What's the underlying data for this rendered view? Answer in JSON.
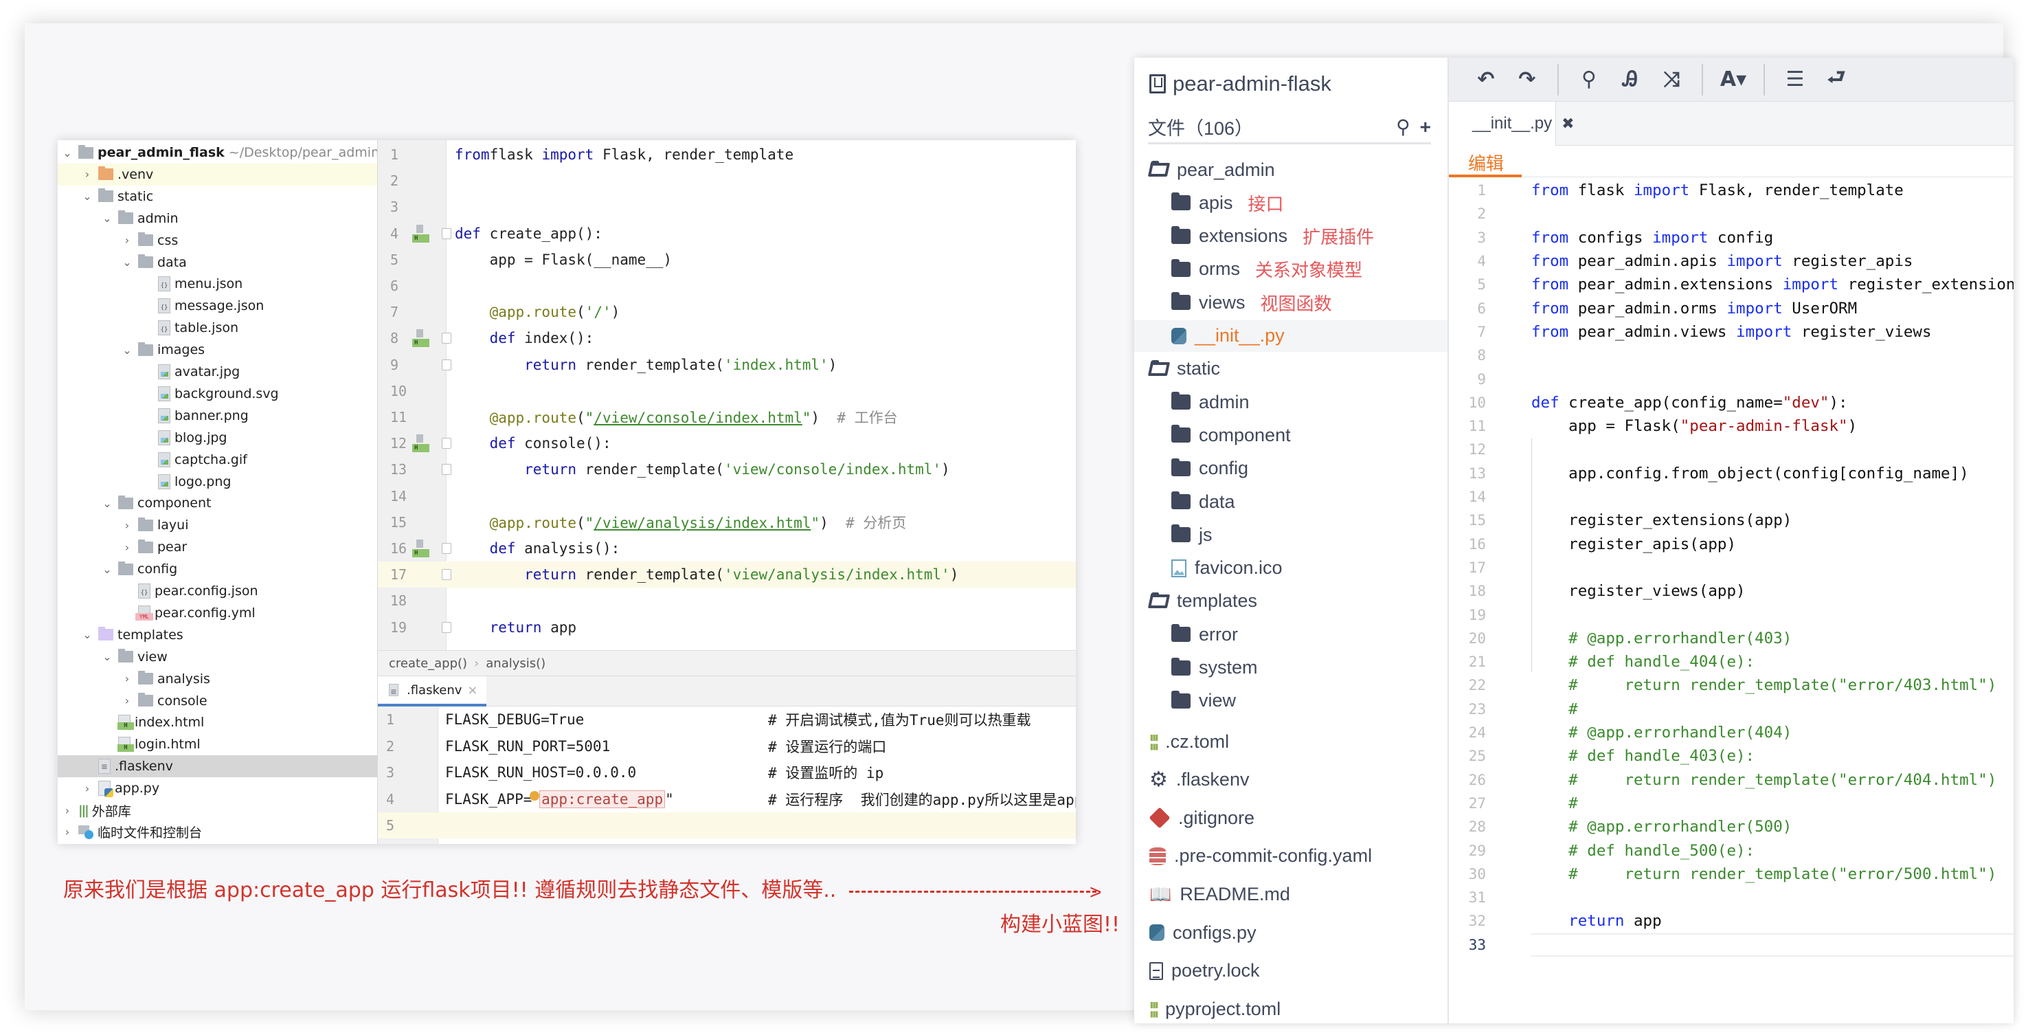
{
  "left_ide": {
    "project_tree": [
      {
        "label": "pear_admin_flask",
        "suffix": "~/Desktop/pear_admin",
        "depth": 0,
        "chevron": "down",
        "icon": "folder-icon",
        "bold": true
      },
      {
        "label": ".venv",
        "depth": 1,
        "chevron": "right",
        "icon": "folder-excluded-icon",
        "highlight": "yellow"
      },
      {
        "label": "static",
        "depth": 1,
        "chevron": "down",
        "icon": "folder-icon"
      },
      {
        "label": "admin",
        "depth": 2,
        "chevron": "down",
        "icon": "folder-icon"
      },
      {
        "label": "css",
        "depth": 3,
        "chevron": "right",
        "icon": "folder-icon"
      },
      {
        "label": "data",
        "depth": 3,
        "chevron": "down",
        "icon": "folder-icon"
      },
      {
        "label": "menu.json",
        "depth": 4,
        "icon": "json-file-icon"
      },
      {
        "label": "message.json",
        "depth": 4,
        "icon": "json-file-icon"
      },
      {
        "label": "table.json",
        "depth": 4,
        "icon": "json-file-icon"
      },
      {
        "label": "images",
        "depth": 3,
        "chevron": "down",
        "icon": "folder-icon"
      },
      {
        "label": "avatar.jpg",
        "depth": 4,
        "icon": "image-file-icon"
      },
      {
        "label": "background.svg",
        "depth": 4,
        "icon": "image-file-icon"
      },
      {
        "label": "banner.png",
        "depth": 4,
        "icon": "image-file-icon"
      },
      {
        "label": "blog.jpg",
        "depth": 4,
        "icon": "image-file-icon"
      },
      {
        "label": "captcha.gif",
        "depth": 4,
        "icon": "image-file-icon"
      },
      {
        "label": "logo.png",
        "depth": 4,
        "icon": "image-file-icon"
      },
      {
        "label": "component",
        "depth": 2,
        "chevron": "down",
        "icon": "folder-icon"
      },
      {
        "label": "layui",
        "depth": 3,
        "chevron": "right",
        "icon": "folder-icon"
      },
      {
        "label": "pear",
        "depth": 3,
        "chevron": "right",
        "icon": "folder-icon"
      },
      {
        "label": "config",
        "depth": 2,
        "chevron": "down",
        "icon": "folder-icon"
      },
      {
        "label": "pear.config.json",
        "depth": 3,
        "icon": "json-file-icon"
      },
      {
        "label": "pear.config.yml",
        "depth": 3,
        "icon": "yml-file-icon"
      },
      {
        "label": "templates",
        "depth": 1,
        "chevron": "down",
        "icon": "templates-folder-icon"
      },
      {
        "label": "view",
        "depth": 2,
        "chevron": "down",
        "icon": "folder-icon"
      },
      {
        "label": "analysis",
        "depth": 3,
        "chevron": "right",
        "icon": "folder-icon"
      },
      {
        "label": "console",
        "depth": 3,
        "chevron": "right",
        "icon": "folder-icon"
      },
      {
        "label": "index.html",
        "depth": 2,
        "icon": "html-file-icon"
      },
      {
        "label": "login.html",
        "depth": 2,
        "icon": "html-file-icon"
      },
      {
        "label": ".flaskenv",
        "depth": 1,
        "icon": "text-file-icon",
        "highlight": "gray"
      },
      {
        "label": "app.py",
        "depth": 1,
        "chevron": "right",
        "icon": "python-file-icon"
      },
      {
        "label": "外部库",
        "depth": 0,
        "chevron": "right",
        "icon": "library-icon"
      },
      {
        "label": "临时文件和控制台",
        "depth": 0,
        "chevron": "right",
        "icon": "scratch-icon"
      }
    ],
    "editor_lines": [
      {
        "n": "1",
        "tokens": [
          [
            "kw",
            "from"
          ],
          [
            "",
            "flask "
          ],
          [
            "kw",
            "import"
          ],
          [
            "",
            " Flask, render_template"
          ]
        ]
      },
      {
        "n": "2",
        "tokens": []
      },
      {
        "n": "3",
        "tokens": []
      },
      {
        "n": "4",
        "gutter_html": true,
        "fold": true,
        "tokens": [
          [
            "kw",
            "def"
          ],
          [
            "",
            " create_app():"
          ]
        ]
      },
      {
        "n": "5",
        "tokens": [
          [
            "",
            "    app = Flask(__name__)"
          ]
        ]
      },
      {
        "n": "6",
        "tokens": []
      },
      {
        "n": "7",
        "tokens": [
          [
            "deco",
            "    @app.route"
          ],
          [
            "",
            "("
          ],
          [
            "str",
            "'/'"
          ],
          [
            "",
            ")"
          ]
        ]
      },
      {
        "n": "8",
        "gutter_html": true,
        "fold": true,
        "tokens": [
          [
            "kw",
            "    def"
          ],
          [
            "",
            " index():"
          ]
        ]
      },
      {
        "n": "9",
        "fold": true,
        "tokens": [
          [
            "kw",
            "        return"
          ],
          [
            "",
            " render_template("
          ],
          [
            "str",
            "'index.html'"
          ],
          [
            "",
            ")"
          ]
        ]
      },
      {
        "n": "10",
        "tokens": []
      },
      {
        "n": "11",
        "tokens": [
          [
            "deco",
            "    @app.route"
          ],
          [
            "",
            "("
          ],
          [
            "str",
            "\""
          ],
          [
            "str ul",
            "/view/console/index.html"
          ],
          [
            "str",
            "\""
          ],
          [
            "",
            ")  "
          ],
          [
            "cmt",
            "# 工作台"
          ]
        ]
      },
      {
        "n": "12",
        "gutter_html": true,
        "fold": true,
        "tokens": [
          [
            "kw",
            "    def"
          ],
          [
            "",
            " console():"
          ]
        ]
      },
      {
        "n": "13",
        "fold": true,
        "tokens": [
          [
            "kw",
            "        return"
          ],
          [
            "",
            " render_template("
          ],
          [
            "str",
            "'view/console/index.html'"
          ],
          [
            "",
            ")"
          ]
        ]
      },
      {
        "n": "14",
        "tokens": []
      },
      {
        "n": "15",
        "tokens": [
          [
            "deco",
            "    @app.route"
          ],
          [
            "",
            "("
          ],
          [
            "str",
            "\""
          ],
          [
            "str ul",
            "/view/analysis/index.html"
          ],
          [
            "str",
            "\""
          ],
          [
            "",
            ")  "
          ],
          [
            "cmt",
            "# 分析页"
          ]
        ]
      },
      {
        "n": "16",
        "gutter_html": true,
        "fold": true,
        "tokens": [
          [
            "kw",
            "    def"
          ],
          [
            "",
            " analysis():"
          ]
        ]
      },
      {
        "n": "17",
        "active": true,
        "fold": true,
        "tokens": [
          [
            "kw",
            "        return"
          ],
          [
            "",
            " render_template("
          ],
          [
            "str",
            "'view/analysis/index.html'"
          ],
          [
            "",
            ")"
          ]
        ]
      },
      {
        "n": "18",
        "tokens": []
      },
      {
        "n": "19",
        "fold": true,
        "tokens": [
          [
            "kw",
            "    return"
          ],
          [
            "",
            " app"
          ]
        ]
      }
    ],
    "breadcrumb": [
      "create_app()",
      "analysis()"
    ],
    "env_tab": {
      "label": ".flaskenv",
      "close": "×"
    },
    "env_lines": [
      {
        "n": "1",
        "code": "FLASK_DEBUG=True",
        "comment": "# 开启调试模式,值为True则可以热重载"
      },
      {
        "n": "2",
        "code": "FLASK_RUN_PORT=5001",
        "comment": "# 设置运行的端口"
      },
      {
        "n": "3",
        "code": "FLASK_RUN_HOST=0.0.0.0",
        "comment": "# 设置监听的 ip"
      },
      {
        "n": "4",
        "code_prefix": "FLASK_APP=\"",
        "code_boxed": "app:create_app",
        "code_suffix": "\"",
        "comment": "# 运行程序  我们创建的app.py所以这里是app"
      },
      {
        "n": "5",
        "code": "",
        "comment": "",
        "active": true
      }
    ]
  },
  "annotation": {
    "main": "原来我们是根据 app:create_app 运行flask项目!! 遵循规则去找静态文件、模版等..",
    "arrow": ">",
    "secondary": "构建小蓝图!!",
    "color": "#d2332b"
  },
  "right_repo": {
    "title": "pear-admin-flask",
    "files_header": "文件（106）",
    "search_icon": "🔍",
    "add_icon": "+",
    "tree": [
      {
        "label": "pear_admin",
        "depth": 0,
        "icon": "folder-open-icon"
      },
      {
        "label": "apis",
        "depth": 1,
        "icon": "folder-icon",
        "note": "接口"
      },
      {
        "label": "extensions",
        "depth": 1,
        "icon": "folder-icon",
        "note": "扩展插件"
      },
      {
        "label": "orms",
        "depth": 1,
        "icon": "folder-icon",
        "note": "关系对象模型"
      },
      {
        "label": "views",
        "depth": 1,
        "icon": "folder-icon",
        "note": "视图函数"
      },
      {
        "label": "__init__.py",
        "depth": 1,
        "icon": "python-icon",
        "selected": true
      },
      {
        "label": "static",
        "depth": 0,
        "icon": "folder-open-icon"
      },
      {
        "label": "admin",
        "depth": 1,
        "icon": "folder-icon"
      },
      {
        "label": "component",
        "depth": 1,
        "icon": "folder-icon"
      },
      {
        "label": "config",
        "depth": 1,
        "icon": "folder-icon"
      },
      {
        "label": "data",
        "depth": 1,
        "icon": "folder-icon"
      },
      {
        "label": "js",
        "depth": 1,
        "icon": "folder-icon"
      },
      {
        "label": "favicon.ico",
        "depth": 1,
        "icon": "image-icon"
      },
      {
        "label": "templates",
        "depth": 0,
        "icon": "folder-open-icon"
      },
      {
        "label": "error",
        "depth": 1,
        "icon": "folder-icon"
      },
      {
        "label": "system",
        "depth": 1,
        "icon": "folder-icon"
      },
      {
        "label": "view",
        "depth": 1,
        "icon": "folder-icon"
      },
      {
        "label": ".cz.toml",
        "depth": 0,
        "icon": "toml-icon"
      },
      {
        "label": ".flaskenv",
        "depth": 0,
        "icon": "gear-icon"
      },
      {
        "label": ".gitignore",
        "depth": 0,
        "icon": "git-icon"
      },
      {
        "label": ".pre-commit-config.yaml",
        "depth": 0,
        "icon": "database-icon"
      },
      {
        "label": "README.md",
        "depth": 0,
        "icon": "book-icon"
      },
      {
        "label": "configs.py",
        "depth": 0,
        "icon": "python-icon"
      },
      {
        "label": "poetry.lock",
        "depth": 0,
        "icon": "document-icon"
      },
      {
        "label": "pyproject.toml",
        "depth": 0,
        "icon": "toml-icon"
      }
    ],
    "toolbar": [
      {
        "name": "undo-button",
        "glyph": "↶"
      },
      {
        "name": "redo-button",
        "glyph": "↷"
      },
      {
        "sep": true
      },
      {
        "name": "search-button",
        "glyph": "⚲"
      },
      {
        "name": "find-replace-button",
        "glyph": "Ꭿ"
      },
      {
        "name": "shuffle-button",
        "glyph": "⤨"
      },
      {
        "sep": true
      },
      {
        "name": "font-button",
        "glyph": "A▾"
      },
      {
        "sep": true
      },
      {
        "name": "list-button",
        "glyph": "☰"
      },
      {
        "name": "wrap-button",
        "glyph": "⮐"
      }
    ],
    "file_tab": {
      "label": "__init__.py",
      "close": "✖"
    },
    "mode_tab": "编辑",
    "code_lines": [
      {
        "n": "1",
        "tokens": [
          [
            "rkw",
            "from"
          ],
          [
            "",
            " flask "
          ],
          [
            "rkw",
            "import"
          ],
          [
            "",
            " Flask, render_template"
          ]
        ]
      },
      {
        "n": "2",
        "tokens": []
      },
      {
        "n": "3",
        "tokens": [
          [
            "rkw",
            "from"
          ],
          [
            "",
            " configs "
          ],
          [
            "rkw",
            "import"
          ],
          [
            "",
            " config"
          ]
        ]
      },
      {
        "n": "4",
        "tokens": [
          [
            "rkw",
            "from"
          ],
          [
            "",
            " pear_admin.apis "
          ],
          [
            "rkw",
            "import"
          ],
          [
            "",
            " register_apis"
          ]
        ]
      },
      {
        "n": "5",
        "tokens": [
          [
            "rkw",
            "from"
          ],
          [
            "",
            " pear_admin.extensions "
          ],
          [
            "rkw",
            "import"
          ],
          [
            "",
            " register_extensions"
          ]
        ]
      },
      {
        "n": "6",
        "tokens": [
          [
            "rkw",
            "from"
          ],
          [
            "",
            " pear_admin.orms "
          ],
          [
            "rkw",
            "import"
          ],
          [
            "",
            " UserORM"
          ]
        ]
      },
      {
        "n": "7",
        "tokens": [
          [
            "rkw",
            "from"
          ],
          [
            "",
            " pear_admin.views "
          ],
          [
            "rkw",
            "import"
          ],
          [
            "",
            " register_views"
          ]
        ]
      },
      {
        "n": "8",
        "tokens": []
      },
      {
        "n": "9",
        "tokens": []
      },
      {
        "n": "10",
        "tokens": [
          [
            "rkw",
            "def"
          ],
          [
            "",
            " create_app(config_name="
          ],
          [
            "rstr",
            "\"dev\""
          ],
          [
            "",
            "):"
          ]
        ]
      },
      {
        "n": "11",
        "tokens": [
          [
            "",
            "    app = Flask("
          ],
          [
            "rstr",
            "\"pear-admin-flask\""
          ],
          [
            "",
            ")"
          ]
        ]
      },
      {
        "n": "12",
        "tokens": []
      },
      {
        "n": "13",
        "tokens": [
          [
            "",
            "    app.config.from_object(config[config_name])"
          ]
        ]
      },
      {
        "n": "14",
        "tokens": []
      },
      {
        "n": "15",
        "tokens": [
          [
            "",
            "    register_extensions(app)"
          ]
        ]
      },
      {
        "n": "16",
        "tokens": [
          [
            "",
            "    register_apis(app)"
          ]
        ]
      },
      {
        "n": "17",
        "tokens": []
      },
      {
        "n": "18",
        "tokens": [
          [
            "",
            "    register_views(app)"
          ]
        ]
      },
      {
        "n": "19",
        "tokens": []
      },
      {
        "n": "20",
        "tokens": [
          [
            "rcm",
            "    # @app.errorhandler(403)"
          ]
        ]
      },
      {
        "n": "21",
        "tokens": [
          [
            "rcm",
            "    # def handle_404(e):"
          ]
        ]
      },
      {
        "n": "22",
        "tokens": [
          [
            "rcm",
            "    #     return render_template(\"error/403.html\")"
          ]
        ]
      },
      {
        "n": "23",
        "tokens": [
          [
            "rcm",
            "    #"
          ]
        ]
      },
      {
        "n": "24",
        "tokens": [
          [
            "rcm",
            "    # @app.errorhandler(404)"
          ]
        ]
      },
      {
        "n": "25",
        "tokens": [
          [
            "rcm",
            "    # def handle_403(e):"
          ]
        ]
      },
      {
        "n": "26",
        "tokens": [
          [
            "rcm",
            "    #     return render_template(\"error/404.html\")"
          ]
        ]
      },
      {
        "n": "27",
        "tokens": [
          [
            "rcm",
            "    #"
          ]
        ]
      },
      {
        "n": "28",
        "tokens": [
          [
            "rcm",
            "    # @app.errorhandler(500)"
          ]
        ]
      },
      {
        "n": "29",
        "tokens": [
          [
            "rcm",
            "    # def handle_500(e):"
          ]
        ]
      },
      {
        "n": "30",
        "tokens": [
          [
            "rcm",
            "    #     return render_template(\"error/500.html\")"
          ]
        ]
      },
      {
        "n": "31",
        "tokens": []
      },
      {
        "n": "32",
        "tokens": [
          [
            "rkw",
            "    return"
          ],
          [
            "",
            " app"
          ]
        ]
      },
      {
        "n": "33",
        "tokens": [],
        "current": true
      }
    ]
  }
}
